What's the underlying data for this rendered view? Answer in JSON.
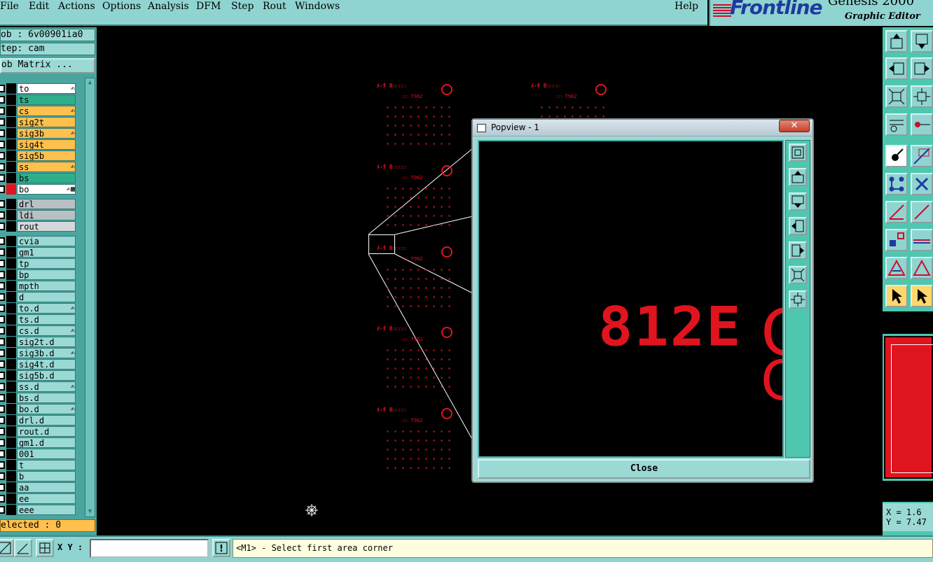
{
  "menubar": {
    "items": [
      "File",
      "Edit",
      "Actions",
      "Options",
      "Analysis",
      "DFM",
      "Step",
      "Rout",
      "Windows"
    ],
    "help": "Help"
  },
  "logo": {
    "brand": "Frontline",
    "product": "Genesis 2000",
    "subtitle": "Graphic Editor",
    "brand_color": "#1f3a9e",
    "accent_color": "#c8102e"
  },
  "left_panel": {
    "job_label": "ob : 6v00901ia0",
    "step_label": "tep: cam",
    "job_matrix_button": "ob Matrix ...",
    "selected_label": "elected : 0",
    "layers": [
      {
        "name": "to",
        "color": "#ffffff",
        "flag": "✍"
      },
      {
        "name": "ts",
        "color": "#2fae8a",
        "flag": ""
      },
      {
        "name": "cs",
        "color": "#ffc04d",
        "flag": "✍"
      },
      {
        "name": "sig2t",
        "color": "#ffc04d",
        "flag": ""
      },
      {
        "name": "sig3b",
        "color": "#ffc04d",
        "flag": "✍"
      },
      {
        "name": "sig4t",
        "color": "#ffc04d",
        "flag": ""
      },
      {
        "name": "sig5b",
        "color": "#ffc04d",
        "flag": ""
      },
      {
        "name": "ss",
        "color": "#ffc04d",
        "flag": "✍"
      },
      {
        "name": "bs",
        "color": "#2fae8a",
        "flag": ""
      },
      {
        "name": "bo",
        "color": "#ffffff",
        "flag": "✍▦",
        "active": true
      },
      {
        "name": "drl",
        "color": "#b8c0c4",
        "flag": ""
      },
      {
        "name": "ldi",
        "color": "#b8c0c4",
        "flag": ""
      },
      {
        "name": "rout",
        "color": "#d4d8da",
        "flag": ""
      },
      {
        "name": "cvia",
        "color": "#9bd9d5",
        "flag": ""
      },
      {
        "name": "gm1",
        "color": "#9bd9d5",
        "flag": ""
      },
      {
        "name": "tp",
        "color": "#9bd9d5",
        "flag": ""
      },
      {
        "name": "bp",
        "color": "#9bd9d5",
        "flag": ""
      },
      {
        "name": "mpth",
        "color": "#9bd9d5",
        "flag": ""
      },
      {
        "name": "d",
        "color": "#9bd9d5",
        "flag": ""
      },
      {
        "name": "to.d",
        "color": "#9bd9d5",
        "flag": "✍"
      },
      {
        "name": "ts.d",
        "color": "#9bd9d5",
        "flag": ""
      },
      {
        "name": "cs.d",
        "color": "#9bd9d5",
        "flag": "✍"
      },
      {
        "name": "sig2t.d",
        "color": "#9bd9d5",
        "flag": ""
      },
      {
        "name": "sig3b.d",
        "color": "#9bd9d5",
        "flag": "✍"
      },
      {
        "name": "sig4t.d",
        "color": "#9bd9d5",
        "flag": ""
      },
      {
        "name": "sig5b.d",
        "color": "#9bd9d5",
        "flag": ""
      },
      {
        "name": "ss.d",
        "color": "#9bd9d5",
        "flag": "✍"
      },
      {
        "name": "bs.d",
        "color": "#9bd9d5",
        "flag": ""
      },
      {
        "name": "bo.d",
        "color": "#9bd9d5",
        "flag": "✍"
      },
      {
        "name": "drl.d",
        "color": "#9bd9d5",
        "flag": ""
      },
      {
        "name": "rout.d",
        "color": "#9bd9d5",
        "flag": ""
      },
      {
        "name": "gm1.d",
        "color": "#9bd9d5",
        "flag": ""
      },
      {
        "name": "001",
        "color": "#9bd9d5",
        "flag": ""
      },
      {
        "name": "t",
        "color": "#9bd9d5",
        "flag": ""
      },
      {
        "name": "b",
        "color": "#9bd9d5",
        "flag": ""
      },
      {
        "name": "aa",
        "color": "#9bd9d5",
        "flag": ""
      },
      {
        "name": "ee",
        "color": "#9bd9d5",
        "flag": ""
      },
      {
        "name": "eee",
        "color": "#9bd9d5",
        "flag": ""
      }
    ]
  },
  "popview": {
    "title": "Popview - 1",
    "close_x": "✕",
    "close_button": "Close",
    "zoom_text": "812E",
    "edge_glyph_1": "C",
    "edge_glyph_2": "C",
    "tools": [
      "zoom-fit-icon",
      "pan-up-icon",
      "pan-down-icon",
      "pan-left-icon",
      "pan-right-icon",
      "zoom-out-icon",
      "zoom-in-icon"
    ]
  },
  "coords": {
    "x_label": "X = 1.6",
    "y_label": "Y = 7.47"
  },
  "statusbar": {
    "xy_label": "X Y :",
    "xy_value": "",
    "warn_icon": "!",
    "prompt": "<M1> - Select first area corner"
  },
  "colors": {
    "panel": "#8fd4d0",
    "panel_dark": "#4aa59f",
    "feature": "#e0141e",
    "highlight": "#ffc04d"
  }
}
